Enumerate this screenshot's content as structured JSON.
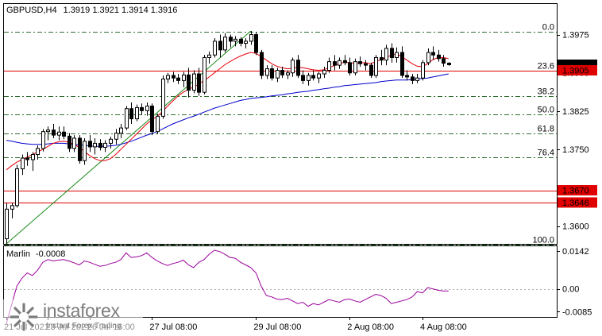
{
  "header": {
    "symbol": "GBPUSD,H4",
    "ohlc": "1.3919 1.3921 1.3914 1.3916"
  },
  "indicator": {
    "name": "Marlin",
    "value": "-0.0008",
    "levels": [
      "0.0142",
      "0.00",
      "-0.0085"
    ]
  },
  "colors": {
    "ma_fast": "#e8000b",
    "ma_slow": "#0000cc",
    "fib": "#2e6b2e",
    "level_line": "#e00000",
    "marlin": "#9b009b",
    "current_price_bg": "#000000",
    "level_bg": "#e00000"
  },
  "price_axis": {
    "ticks": [
      "1.3975",
      "1.3900",
      "1.3825",
      "1.3750",
      "1.3675",
      "1.3600"
    ],
    "current_price": "1.3916",
    "levels": [
      "1.3905",
      "1.3670",
      "1.3646"
    ]
  },
  "fib_levels": [
    "0.0",
    "23.6",
    "38.2",
    "50.0",
    "61.8",
    "76.4",
    "100.0"
  ],
  "time_axis": [
    "21 Jul 2021",
    "23 Jul 2021",
    "26 Jul 16:00",
    "27 Jul 08:00",
    "29 Jul 08:00",
    "2 Aug 08:00",
    "4 Aug 08:00"
  ],
  "watermark": {
    "brand": "instaforex",
    "tagline": "Instant Forex Trading"
  },
  "chart_data": {
    "type": "candlestick",
    "title": "GBPUSD,H4",
    "ylim": [
      1.3565,
      1.4035
    ],
    "fib_prices": [
      1.398,
      1.3904,
      1.3855,
      1.3819,
      1.3781,
      1.3734,
      1.3563
    ],
    "level_prices": [
      1.3905,
      1.367,
      1.3646
    ],
    "candles": [
      [
        1.3575,
        1.3645,
        1.3565,
        1.3633
      ],
      [
        1.3633,
        1.3645,
        1.3615,
        1.364
      ],
      [
        1.364,
        1.372,
        1.3636,
        1.3712
      ],
      [
        1.3712,
        1.374,
        1.37,
        1.3733
      ],
      [
        1.3733,
        1.3745,
        1.3718,
        1.373
      ],
      [
        1.373,
        1.3745,
        1.3708,
        1.374
      ],
      [
        1.374,
        1.3758,
        1.373,
        1.3752
      ],
      [
        1.3752,
        1.379,
        1.3746,
        1.3785
      ],
      [
        1.3785,
        1.3795,
        1.3768,
        1.3788
      ],
      [
        1.3788,
        1.38,
        1.3772,
        1.3778
      ],
      [
        1.3778,
        1.3795,
        1.3768,
        1.3784
      ],
      [
        1.3784,
        1.3795,
        1.377,
        1.3776
      ],
      [
        1.3776,
        1.3782,
        1.3745,
        1.3752
      ],
      [
        1.3752,
        1.3778,
        1.3745,
        1.3772
      ],
      [
        1.3772,
        1.3778,
        1.3722,
        1.3728
      ],
      [
        1.3728,
        1.3772,
        1.372,
        1.3766
      ],
      [
        1.3766,
        1.3778,
        1.3745,
        1.3755
      ],
      [
        1.3755,
        1.3772,
        1.374,
        1.3762
      ],
      [
        1.3762,
        1.377,
        1.3748,
        1.3754
      ],
      [
        1.3754,
        1.3768,
        1.3745,
        1.3762
      ],
      [
        1.3762,
        1.3775,
        1.3752,
        1.377
      ],
      [
        1.377,
        1.379,
        1.376,
        1.3782
      ],
      [
        1.3782,
        1.38,
        1.3772,
        1.3792
      ],
      [
        1.3792,
        1.3835,
        1.3788,
        1.383
      ],
      [
        1.383,
        1.3842,
        1.38,
        1.381
      ],
      [
        1.381,
        1.3838,
        1.3805,
        1.3832
      ],
      [
        1.3832,
        1.384,
        1.3818,
        1.3826
      ],
      [
        1.3826,
        1.3842,
        1.3816,
        1.3835
      ],
      [
        1.3835,
        1.384,
        1.3778,
        1.3785
      ],
      [
        1.3785,
        1.382,
        1.378,
        1.3815
      ],
      [
        1.3815,
        1.3895,
        1.381,
        1.3888
      ],
      [
        1.3888,
        1.39,
        1.388,
        1.3895
      ],
      [
        1.3895,
        1.3902,
        1.3882,
        1.389
      ],
      [
        1.389,
        1.3898,
        1.3878,
        1.3885
      ],
      [
        1.3885,
        1.3902,
        1.3872,
        1.3896
      ],
      [
        1.3896,
        1.391,
        1.3852,
        1.3866
      ],
      [
        1.3866,
        1.3905,
        1.386,
        1.3898
      ],
      [
        1.3898,
        1.391,
        1.3855,
        1.3862
      ],
      [
        1.3862,
        1.3935,
        1.3858,
        1.393
      ],
      [
        1.393,
        1.3942,
        1.3918,
        1.3935
      ],
      [
        1.3935,
        1.3968,
        1.393,
        1.3962
      ],
      [
        1.3962,
        1.3975,
        1.393,
        1.3945
      ],
      [
        1.3945,
        1.3978,
        1.394,
        1.397
      ],
      [
        1.397,
        1.3975,
        1.395,
        1.3962
      ],
      [
        1.3962,
        1.3972,
        1.3952,
        1.3966
      ],
      [
        1.3966,
        1.397,
        1.3952,
        1.3958
      ],
      [
        1.3958,
        1.3968,
        1.3948,
        1.3962
      ],
      [
        1.3962,
        1.3982,
        1.3955,
        1.3975
      ],
      [
        1.3975,
        1.398,
        1.3935,
        1.394
      ],
      [
        1.394,
        1.3945,
        1.3888,
        1.3895
      ],
      [
        1.3895,
        1.3915,
        1.3888,
        1.3908
      ],
      [
        1.3908,
        1.3915,
        1.3885,
        1.389
      ],
      [
        1.389,
        1.391,
        1.3882,
        1.3905
      ],
      [
        1.3905,
        1.3912,
        1.389,
        1.3896
      ],
      [
        1.3896,
        1.3905,
        1.3888,
        1.39
      ],
      [
        1.39,
        1.393,
        1.3892,
        1.3925
      ],
      [
        1.3925,
        1.3935,
        1.389,
        1.3895
      ],
      [
        1.3895,
        1.3905,
        1.3878,
        1.3885
      ],
      [
        1.3885,
        1.39,
        1.3875,
        1.3895
      ],
      [
        1.3895,
        1.3905,
        1.3885,
        1.389
      ],
      [
        1.389,
        1.3902,
        1.388,
        1.3898
      ],
      [
        1.3898,
        1.3912,
        1.389,
        1.3905
      ],
      [
        1.3905,
        1.393,
        1.39,
        1.3922
      ],
      [
        1.3922,
        1.3935,
        1.3905,
        1.3915
      ],
      [
        1.3915,
        1.393,
        1.3908,
        1.3924
      ],
      [
        1.3924,
        1.3935,
        1.3915,
        1.392
      ],
      [
        1.392,
        1.393,
        1.3895,
        1.39
      ],
      [
        1.39,
        1.3928,
        1.3895,
        1.3922
      ],
      [
        1.3922,
        1.3932,
        1.3912,
        1.3918
      ],
      [
        1.3918,
        1.3925,
        1.3905,
        1.3915
      ],
      [
        1.3915,
        1.392,
        1.389,
        1.3895
      ],
      [
        1.3895,
        1.3935,
        1.389,
        1.393
      ],
      [
        1.393,
        1.3945,
        1.3915,
        1.3925
      ],
      [
        1.3925,
        1.3955,
        1.3915,
        1.3948
      ],
      [
        1.3948,
        1.3958,
        1.392,
        1.393
      ],
      [
        1.393,
        1.395,
        1.392,
        1.394
      ],
      [
        1.394,
        1.3952,
        1.389,
        1.3895
      ],
      [
        1.3895,
        1.3905,
        1.3885,
        1.3892
      ],
      [
        1.3892,
        1.3898,
        1.3878,
        1.3885
      ],
      [
        1.3885,
        1.3898,
        1.388,
        1.389
      ],
      [
        1.389,
        1.3925,
        1.3885,
        1.392
      ],
      [
        1.392,
        1.3948,
        1.3915,
        1.394
      ],
      [
        1.394,
        1.3952,
        1.3925,
        1.3935
      ],
      [
        1.3935,
        1.3945,
        1.3922,
        1.3928
      ],
      [
        1.3928,
        1.3935,
        1.3912,
        1.3919
      ],
      [
        1.3919,
        1.3921,
        1.3914,
        1.3916
      ]
    ],
    "ma_fast": [
      1.371,
      1.3718,
      1.3725,
      1.373,
      1.3735,
      1.374,
      1.3745,
      1.375,
      1.3756,
      1.3762,
      1.3765,
      1.3766,
      1.3764,
      1.376,
      1.3754,
      1.3746,
      1.3738,
      1.3732,
      1.3728,
      1.3728,
      1.3732,
      1.374,
      1.375,
      1.376,
      1.377,
      1.378,
      1.379,
      1.38,
      1.3808,
      1.3815,
      1.3824,
      1.3835,
      1.3845,
      1.3855,
      1.3862,
      1.3868,
      1.3872,
      1.3878,
      1.3885,
      1.3892,
      1.39,
      1.3908,
      1.3916,
      1.3922,
      1.3928,
      1.3933,
      1.3937,
      1.394,
      1.3938,
      1.3932,
      1.3925,
      1.3918,
      1.3913,
      1.391,
      1.3908,
      1.3909,
      1.3911,
      1.391,
      1.3908,
      1.3906,
      1.3905,
      1.3906,
      1.391,
      1.3914,
      1.3918,
      1.3921,
      1.392,
      1.3919,
      1.392,
      1.392,
      1.3918,
      1.3922,
      1.3926,
      1.393,
      1.3935,
      1.3937,
      1.3932,
      1.3925,
      1.3918,
      1.3913,
      1.3912,
      1.3918,
      1.3926,
      1.393,
      1.393,
      1.3928
    ],
    "ma_slow": [
      1.3768,
      1.3766,
      1.3764,
      1.3762,
      1.3761,
      1.376,
      1.376,
      1.376,
      1.3761,
      1.3762,
      1.3762,
      1.3762,
      1.3761,
      1.376,
      1.3759,
      1.3758,
      1.3757,
      1.3756,
      1.3756,
      1.3756,
      1.3757,
      1.3758,
      1.376,
      1.3763,
      1.3766,
      1.377,
      1.3774,
      1.3778,
      1.3781,
      1.3785,
      1.379,
      1.3795,
      1.38,
      1.3804,
      1.3808,
      1.3812,
      1.3815,
      1.3819,
      1.3823,
      1.3827,
      1.3831,
      1.3834,
      1.3837,
      1.384,
      1.3843,
      1.3846,
      1.3848,
      1.385,
      1.3851,
      1.3852,
      1.3853,
      1.3855,
      1.3856,
      1.3857,
      1.3859,
      1.386,
      1.3862,
      1.3863,
      1.3864,
      1.3866,
      1.3867,
      1.3869,
      1.387,
      1.3872,
      1.3873,
      1.3875,
      1.3876,
      1.3877,
      1.3878,
      1.3879,
      1.388,
      1.3881,
      1.3883,
      1.3884,
      1.3885,
      1.3886,
      1.3886,
      1.3886,
      1.3887,
      1.3888,
      1.3889,
      1.389,
      1.3892,
      1.3894,
      1.3896,
      1.3898
    ],
    "marlin": [
      -0.013,
      -0.006,
      0.001,
      0.004,
      0.006,
      0.005,
      0.007,
      0.01,
      0.011,
      0.0105,
      0.0108,
      0.011,
      0.0105,
      0.0098,
      0.009,
      0.0105,
      0.01,
      0.0092,
      0.0085,
      0.0088,
      0.0095,
      0.01,
      0.011,
      0.0135,
      0.0118,
      0.012,
      0.0125,
      0.0135,
      0.0118,
      0.0105,
      0.0095,
      0.0088,
      0.0095,
      0.01,
      0.0108,
      0.009,
      0.008,
      0.01,
      0.011,
      0.013,
      0.0145,
      0.014,
      0.013,
      0.0118,
      0.0115,
      0.01,
      0.009,
      0.008,
      0.006,
      0.001,
      -0.0025,
      -0.003,
      -0.0038,
      -0.004,
      -0.0035,
      -0.0045,
      -0.0055,
      -0.005,
      -0.0065,
      -0.0055,
      -0.006,
      -0.005,
      -0.004,
      -0.0045,
      -0.005,
      -0.004,
      -0.0038,
      -0.0045,
      -0.005,
      -0.004,
      -0.003,
      -0.002,
      -0.0025,
      -0.0035,
      -0.0055,
      -0.005,
      -0.0045,
      -0.004,
      -0.003,
      -0.001,
      -0.0015,
      0.0005,
      0.0,
      -0.0005,
      -0.0008,
      -0.0008
    ],
    "marlin_ylim": [
      -0.0105,
      0.016
    ]
  }
}
